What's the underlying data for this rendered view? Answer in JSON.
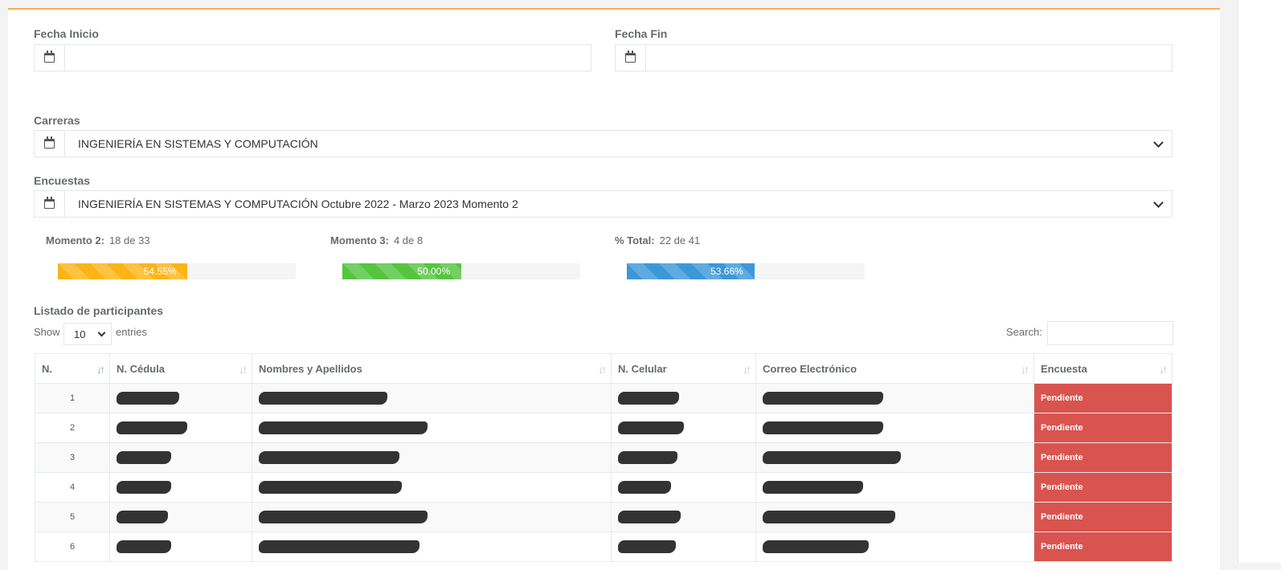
{
  "filters": {
    "start_date_label": "Fecha Inicio",
    "end_date_label": "Fecha Fin",
    "start_date_value": "",
    "end_date_value": "",
    "careers_label": "Carreras",
    "career_selected": "INGENIERÍA EN SISTEMAS Y COMPUTACIÓN",
    "surveys_label": "Encuestas",
    "survey_selected": "INGENIERÍA EN SISTEMAS Y COMPUTACIÓN Octubre 2022 - Marzo 2023 Momento 2"
  },
  "stats": [
    {
      "label": "Momento 2:",
      "value": "18 de 33",
      "percent_text": "54.55%",
      "fraction": 0.5455,
      "color": "#fbb417"
    },
    {
      "label": "Momento 3:",
      "value": "4 de 8",
      "percent_text": "50.00%",
      "fraction": 0.5,
      "color": "#56c43f"
    },
    {
      "label": "% Total:",
      "value": "22 de 41",
      "percent_text": "53.66%",
      "fraction": 0.5366,
      "color": "#3c97d9"
    }
  ],
  "list": {
    "title": "Listado de participantes",
    "show_label": "Show",
    "entries_value": "10",
    "entries_label": "entries",
    "search_label": "Search:",
    "columns": [
      "N.",
      "N. Cédula",
      "Nombres y Apellidos",
      "N. Celular",
      "Correo Electrónico",
      "Encuesta"
    ],
    "rows": [
      {
        "n": "1",
        "status": "Pendiente"
      },
      {
        "n": "2",
        "status": "Pendiente"
      },
      {
        "n": "3",
        "status": "Pendiente"
      },
      {
        "n": "4",
        "status": "Pendiente"
      },
      {
        "n": "5",
        "status": "Pendiente"
      },
      {
        "n": "6",
        "status": "Pendiente"
      }
    ]
  },
  "colors": {
    "accent": "#f8ac59",
    "danger": "#d9534f"
  }
}
